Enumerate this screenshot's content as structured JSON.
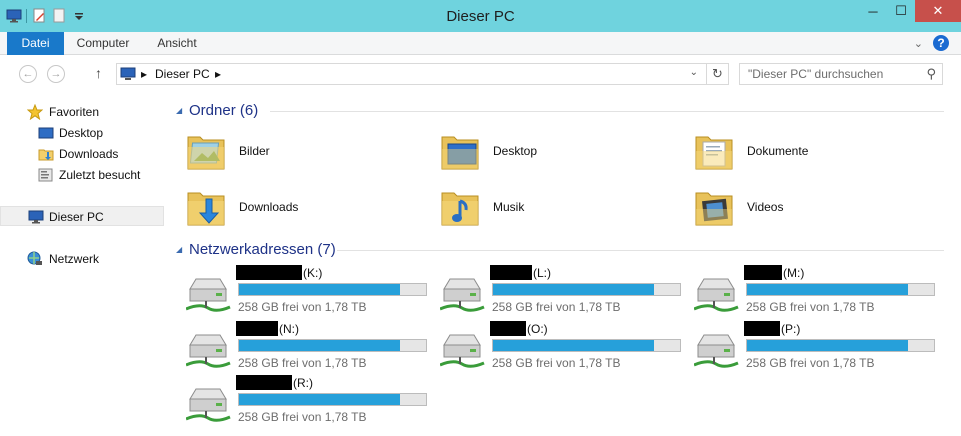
{
  "window": {
    "title": "Dieser PC"
  },
  "quick_access_icons": [
    "computer-icon",
    "properties-icon",
    "new-folder-icon",
    "customize-chevron-icon"
  ],
  "window_buttons": {
    "minimize": "─",
    "maximize": "☐",
    "close": "✕"
  },
  "ribbon": {
    "tabs": [
      "Datei",
      "Computer",
      "Ansicht"
    ],
    "active_tab": "Datei",
    "expand_glyph": "⌄",
    "help_glyph": "?"
  },
  "nav_buttons": {
    "back": "←",
    "forward": "→",
    "up": "↑"
  },
  "address": {
    "crumbs": [
      "Dieser PC"
    ],
    "separator": "▸",
    "dropdown_glyph": "⌄",
    "refresh_glyph": "↻"
  },
  "search": {
    "placeholder": "\"Dieser PC\" durchsuchen",
    "icon_glyph": "⚲"
  },
  "sidebar": {
    "favorites": {
      "label": "Favoriten",
      "items": [
        "Desktop",
        "Downloads",
        "Zuletzt besucht"
      ]
    },
    "this_pc": "Dieser PC",
    "network": "Netzwerk"
  },
  "groups": {
    "folders": {
      "title": "Ordner (6)",
      "items": [
        "Bilder",
        "Desktop",
        "Dokumente",
        "Downloads",
        "Musik",
        "Videos"
      ]
    },
    "network_locations": {
      "title": "Netzwerkadressen (7)",
      "items": [
        {
          "letter": "(K:)",
          "free_text": "258 GB frei von 1,78 TB",
          "used_fraction": 0.86
        },
        {
          "letter": "(L:)",
          "free_text": "258 GB frei von 1,78 TB",
          "used_fraction": 0.86
        },
        {
          "letter": "(M:)",
          "free_text": "258 GB frei von 1,78 TB",
          "used_fraction": 0.86
        },
        {
          "letter": "(N:)",
          "free_text": "258 GB frei von 1,78 TB",
          "used_fraction": 0.86
        },
        {
          "letter": "(O:)",
          "free_text": "258 GB frei von 1,78 TB",
          "used_fraction": 0.86
        },
        {
          "letter": "(P:)",
          "free_text": "258 GB frei von 1,78 TB",
          "used_fraction": 0.86
        },
        {
          "letter": "(R:)",
          "free_text": "258 GB frei von 1,78 TB",
          "used_fraction": 0.86
        }
      ]
    }
  },
  "colors": {
    "title_bar": "#6fd3de",
    "file_tab": "#1979ca",
    "close_button": "#c7504b",
    "group_title": "#1e3287",
    "capacity_fill": "#26a0da"
  }
}
